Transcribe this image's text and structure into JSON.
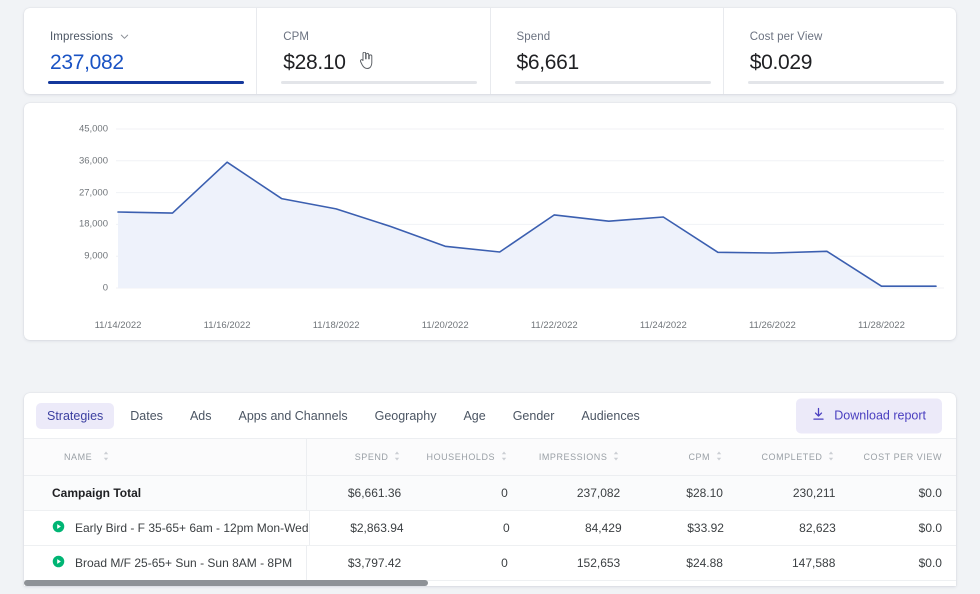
{
  "kpis": [
    {
      "label": "Impressions",
      "value": "237,082",
      "active": true,
      "has_chevron": true
    },
    {
      "label": "CPM",
      "value": "$28.10",
      "active": false,
      "has_chevron": false
    },
    {
      "label": "Spend",
      "value": "$6,661",
      "active": false,
      "has_chevron": false
    },
    {
      "label": "Cost per View",
      "value": "$0.029",
      "active": false,
      "has_chevron": false
    }
  ],
  "chart_data": {
    "type": "area",
    "title": "",
    "xlabel": "",
    "ylabel": "",
    "ylim": [
      0,
      45000
    ],
    "yticks": [
      45000,
      36000,
      27000,
      18000,
      9000,
      0
    ],
    "ytick_labels": [
      "45,000",
      "36,000",
      "27,000",
      "18,000",
      "9,000",
      "0"
    ],
    "grid": true,
    "legend": "none",
    "series_color": "#3b5fb0",
    "fill_color": "#eef2fb",
    "x": [
      "11/14/2022",
      "11/15/2022",
      "11/16/2022",
      "11/17/2022",
      "11/18/2022",
      "11/19/2022",
      "11/20/2022",
      "11/21/2022",
      "11/22/2022",
      "11/23/2022",
      "11/24/2022",
      "11/25/2022",
      "11/26/2022",
      "11/27/2022",
      "11/28/2022",
      "11/29/2022"
    ],
    "xtick_labels": [
      "11/14/2022",
      "11/16/2022",
      "11/18/2022",
      "11/20/2022",
      "11/22/2022",
      "11/24/2022",
      "11/26/2022",
      "11/28/2022"
    ],
    "series": [
      {
        "name": "Impressions",
        "values": [
          21500,
          21200,
          35600,
          25300,
          22400,
          17400,
          11800,
          10200,
          20700,
          18900,
          20100,
          10100,
          9900,
          10400,
          500,
          500
        ]
      }
    ]
  },
  "tabs": [
    {
      "label": "Strategies",
      "active": true
    },
    {
      "label": "Dates",
      "active": false
    },
    {
      "label": "Ads",
      "active": false
    },
    {
      "label": "Apps and Channels",
      "active": false
    },
    {
      "label": "Geography",
      "active": false
    },
    {
      "label": "Age",
      "active": false
    },
    {
      "label": "Gender",
      "active": false
    },
    {
      "label": "Audiences",
      "active": false
    }
  ],
  "download_button": {
    "label": "Download report",
    "icon": "download-icon"
  },
  "table": {
    "columns": [
      "NAME",
      "SPEND",
      "HOUSEHOLDS",
      "IMPRESSIONS",
      "CPM",
      "COMPLETED",
      "COST PER VIEW"
    ],
    "rows": [
      {
        "name": "Campaign Total",
        "is_total": true,
        "status_icon": "",
        "spend": "$6,661.36",
        "households": "0",
        "impressions": "237,082",
        "cpm": "$28.10",
        "completed": "230,211",
        "cost_per_view": "$0.0"
      },
      {
        "name": "Early Bird - F 35-65+ 6am - 12pm Mon-Wed",
        "is_total": false,
        "status_icon": "play-circle-icon",
        "spend": "$2,863.94",
        "households": "0",
        "impressions": "84,429",
        "cpm": "$33.92",
        "completed": "82,623",
        "cost_per_view": "$0.0"
      },
      {
        "name": "Broad M/F 25-65+ Sun - Sun 8AM - 8PM",
        "is_total": false,
        "status_icon": "play-circle-icon",
        "spend": "$3,797.42",
        "households": "0",
        "impressions": "152,653",
        "cpm": "$24.88",
        "completed": "147,588",
        "cost_per_view": "$0.0"
      }
    ]
  },
  "colors": {
    "accent_blue": "#14389c",
    "value_blue": "#1a53c4",
    "tab_active_bg": "#eceaf9",
    "tab_active_text": "#3b3fa0",
    "status_green": "#00b574",
    "line": "#3b5fb0"
  }
}
